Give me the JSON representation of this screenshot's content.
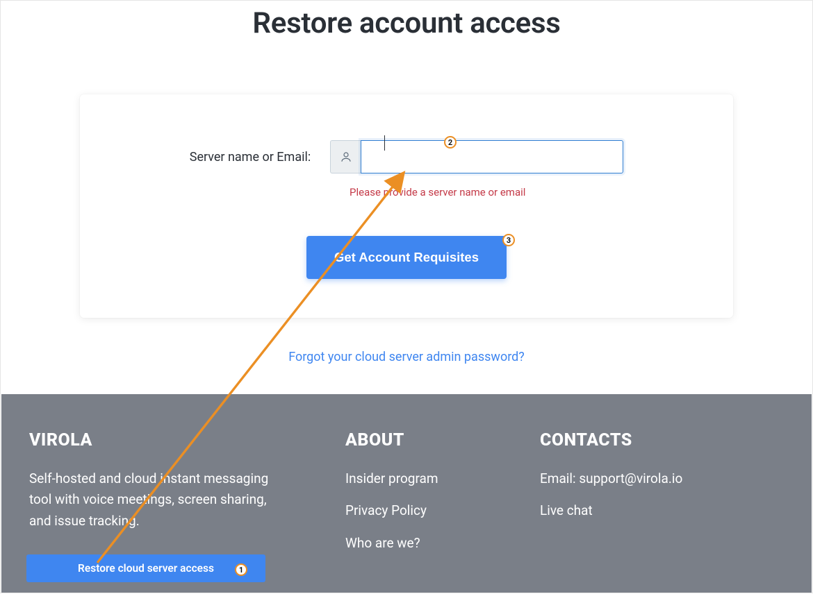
{
  "page": {
    "title": "Restore account access"
  },
  "form": {
    "label": "Server name or Email:",
    "input_value": "",
    "error": "Please provide a server name or email",
    "submit_label": "Get Account Requisites"
  },
  "links": {
    "forgot_password": "Forgot your cloud server admin password?"
  },
  "footer": {
    "brand": "VIROLA",
    "tagline": "Self-hosted and cloud instant messaging tool with voice meetings, screen sharing, and issue tracking.",
    "about_heading": "ABOUT",
    "about_links": [
      "Insider program",
      "Privacy Policy",
      "Who are we?"
    ],
    "contacts_heading": "CONTACTS",
    "contact_email": "Email: support@virola.io",
    "contact_chat": "Live chat",
    "restore_button": "Restore cloud server access"
  },
  "annotations": {
    "marker1": "1",
    "marker2": "2",
    "marker3": "3"
  }
}
